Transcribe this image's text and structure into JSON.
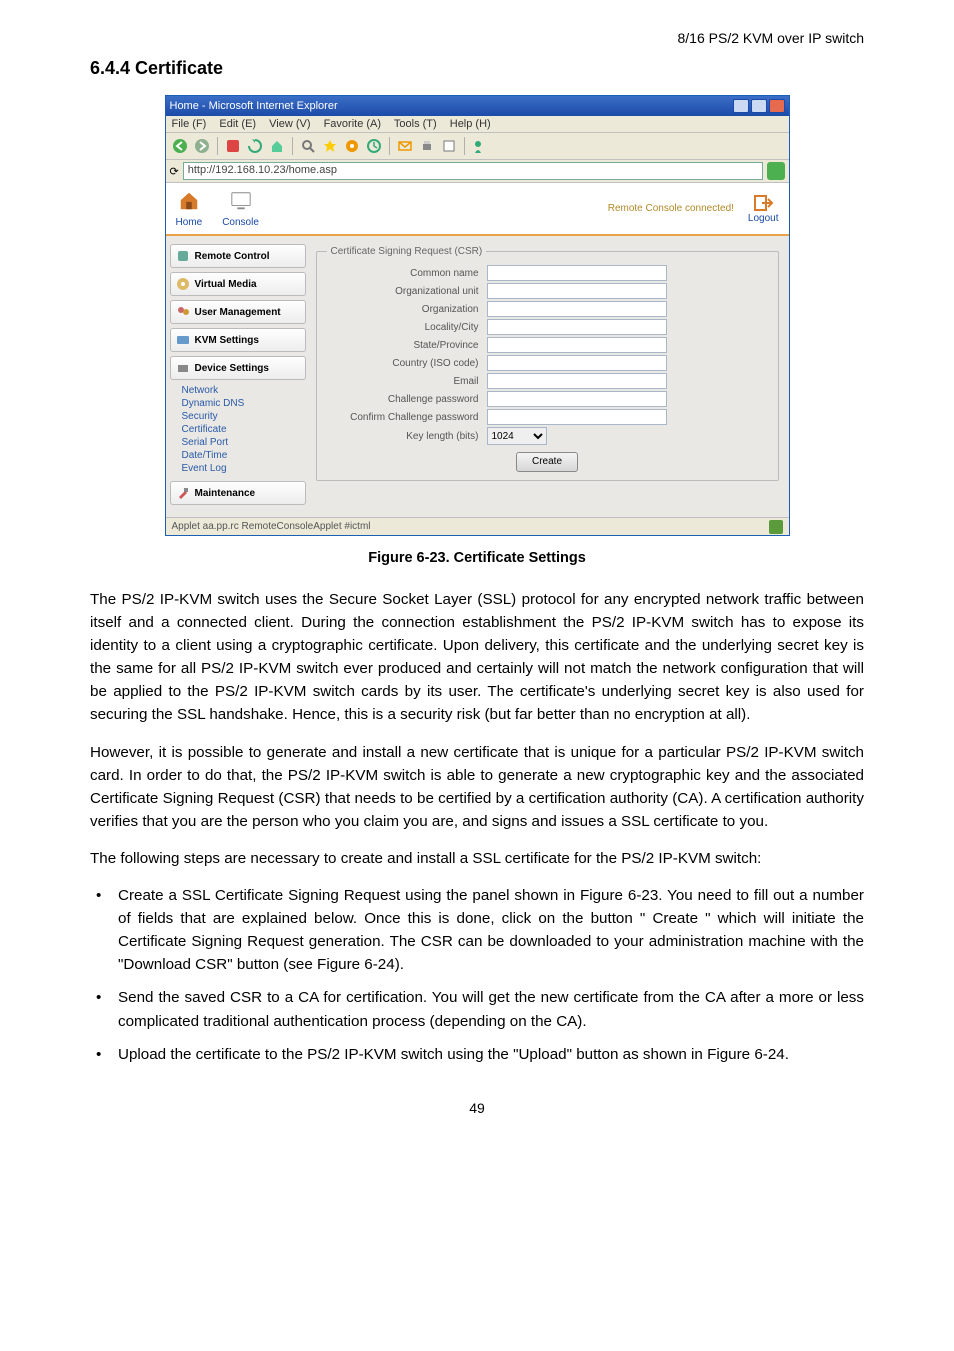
{
  "header_right": "8/16 PS/2 KVM over IP switch",
  "section_heading": "6.4.4    Certificate",
  "browser": {
    "title": "Home - Microsoft Internet Explorer",
    "menu": [
      "File (F)",
      "Edit (E)",
      "View (V)",
      "Favorite (A)",
      "Tools (T)",
      "Help (H)"
    ],
    "address": "http://192.168.10.23/home.asp",
    "statusbar": "Applet aa.pp.rc RemoteConsoleApplet #ictml"
  },
  "app_header": {
    "home": "Home",
    "console": "Console",
    "status": "Remote Console connected!",
    "logout": "Logout"
  },
  "sidebar": {
    "groups": [
      {
        "label": "Remote Control"
      },
      {
        "label": "Virtual Media"
      },
      {
        "label": "User Management"
      },
      {
        "label": "KVM Settings"
      },
      {
        "label": "Device Settings"
      }
    ],
    "device_sub": [
      "Network",
      "Dynamic DNS",
      "Security",
      "Certificate",
      "Serial Port",
      "Date/Time",
      "Event Log"
    ],
    "maintenance": "Maintenance"
  },
  "csr": {
    "legend": "Certificate Signing Request (CSR)",
    "fields": {
      "common_name": "Common name",
      "org_unit": "Organizational unit",
      "organization": "Organization",
      "locality": "Locality/City",
      "state": "State/Province",
      "country": "Country (ISO code)",
      "email": "Email",
      "challenge": "Challenge password",
      "confirm": "Confirm Challenge password",
      "keylen": "Key length (bits)",
      "keylen_value": "1024"
    },
    "create_btn": "Create"
  },
  "figure_caption": "Figure 6-23. Certificate Settings",
  "para1": "The PS/2 IP-KVM switch uses the Secure Socket Layer (SSL) protocol for any encrypted network traffic between itself and a connected client. During the connection establishment the PS/2 IP-KVM switch has to expose its identity to a client using a cryptographic certificate. Upon delivery, this certificate and the underlying secret key is the same for all PS/2 IP-KVM switch ever produced and certainly will not match the network configuration that will be applied to the PS/2 IP-KVM switch cards by its user. The certificate's underlying secret key is also used for securing the SSL handshake. Hence, this is a security risk (but far better than no encryption at all).",
  "para2": "However, it is possible to generate and install a new certificate that is unique for a particular PS/2 IP-KVM switch card. In order to do that, the PS/2 IP-KVM switch is able to generate a new cryptographic key and the associated Certificate Signing Request (CSR) that needs to be certified by a certification authority (CA). A certification authority verifies that you are the person who you claim you are, and signs and issues a SSL certificate to you.",
  "para3": "The following steps are necessary to create and install a SSL certificate for the PS/2 IP-KVM switch:",
  "bullet1": "Create a SSL Certificate Signing Request using the panel shown in Figure 6-23. You need to fill out a number of fields that are explained below. Once this is done, click on the button \" Create \" which will initiate the Certificate Signing Request generation. The CSR can be downloaded to your administration machine with the \"Download CSR\" button (see Figure 6-24).",
  "bullet2": "Send the saved CSR to a CA for certification. You will get the new certificate from the CA after a more or less complicated traditional authentication process (depending on the CA).",
  "bullet3": "Upload the certificate to the PS/2 IP-KVM switch using the \"Upload\" button as shown in Figure 6-24.",
  "page_number": "49"
}
